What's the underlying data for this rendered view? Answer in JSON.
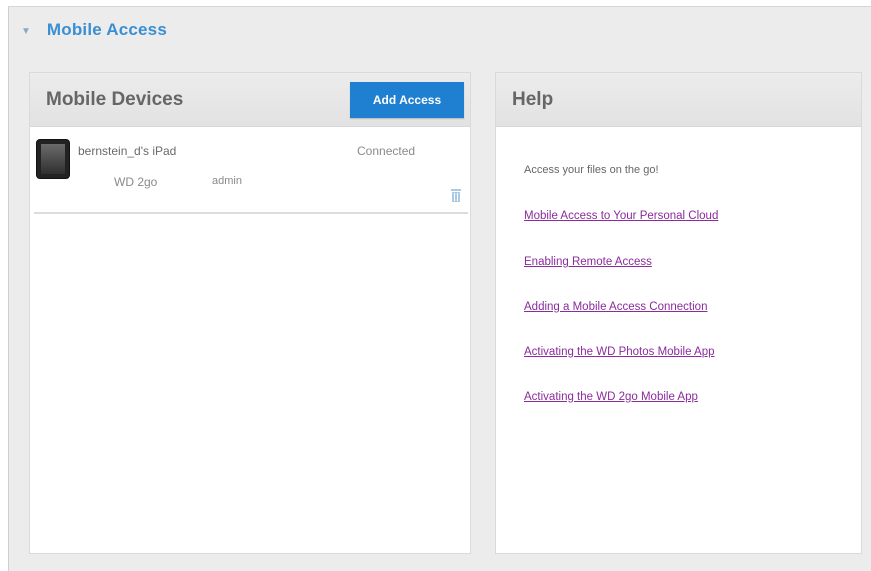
{
  "section": {
    "title": "Mobile Access",
    "chevron_icon": "chevron-down-icon"
  },
  "devices_panel": {
    "title": "Mobile Devices",
    "add_button_label": "Add Access",
    "devices": [
      {
        "name": "bernstein_d's iPad",
        "status": "Connected",
        "app": "WD 2go",
        "user": "admin",
        "icon": "tablet-icon"
      }
    ]
  },
  "help_panel": {
    "title": "Help",
    "intro": "Access your files on the go!",
    "links": [
      "Mobile Access to Your Personal Cloud",
      "Enabling Remote Access",
      "Adding a Mobile Access Connection",
      "Activating the WD Photos Mobile App",
      "Activating the WD 2go Mobile App"
    ]
  },
  "colors": {
    "accent": "#1f7fd0",
    "section_title": "#3a8fd2",
    "link": "#8b2b9c",
    "background": "#ececec"
  }
}
